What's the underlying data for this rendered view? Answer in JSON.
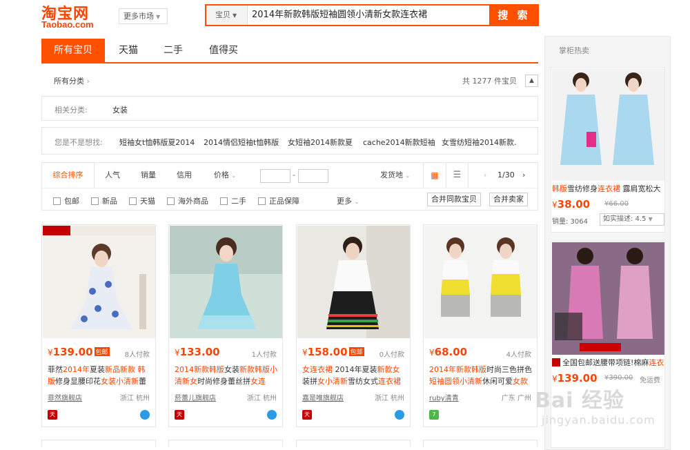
{
  "logo": {
    "cn": "淘宝网",
    "en": "Taobao.com"
  },
  "header": {
    "more_market": "更多市场",
    "search_type": "宝贝",
    "search_query": "2014年新款韩版短袖圆领小清新女款连衣裙",
    "search_button": "搜 索"
  },
  "tabs": [
    {
      "label": "所有宝贝",
      "active": true
    },
    {
      "label": "天猫",
      "active": false
    },
    {
      "label": "二手",
      "active": false
    },
    {
      "label": "值得买",
      "active": false
    }
  ],
  "breadcrumb": {
    "label": "所有分类",
    "count_text": "共 1277 件宝贝"
  },
  "related": {
    "label": "相关分类:",
    "value": "女装"
  },
  "suggest": {
    "label": "您是不是想找:",
    "items": [
      "短袖女t恤韩版夏2014",
      "2014情侣短袖t恤韩版",
      "女短袖2014新款夏",
      "cache2014新款短袖",
      "女雪纺短袖2014新款."
    ]
  },
  "sort": {
    "items": [
      "综合排序",
      "人气",
      "销量",
      "信用",
      "价格"
    ],
    "ship_from": "发货地",
    "page": "1/30",
    "filters": [
      "包邮",
      "新品",
      "天猫",
      "海外商品",
      "二手",
      "正品保障"
    ],
    "more": "更多",
    "merge_same": "合并同款宝贝",
    "merge_seller": "合并卖家"
  },
  "products": [
    {
      "price": "139.00",
      "free_ship": "包邮",
      "paid": "8人付款",
      "title_parts": [
        "菲然",
        "2014年",
        "夏装",
        "新品",
        "新款 ",
        "韩版",
        "修身显腰印花",
        "女装",
        "小清新",
        "蕾"
      ],
      "shop": "菲然旗舰店",
      "location": "浙江 杭州"
    },
    {
      "price": "133.00",
      "free_ship": "",
      "paid": "1人付款",
      "title_parts": [
        "2014新款",
        "韩版",
        "女装",
        "新款",
        "韩版",
        "小清新",
        "女",
        "时尚修身蕾丝拼",
        "女连"
      ],
      "shop": "菸蕾儿旗舰店",
      "location": "浙江 杭州"
    },
    {
      "price": "158.00",
      "free_ship": "包邮",
      "paid": "0人付款",
      "title_parts": [
        "女",
        "连衣裙",
        " 2014年",
        "夏装",
        "新款",
        "女",
        "装拼",
        "女",
        "小清新",
        "雪纺女式",
        "连衣裙"
      ],
      "shop": "嘉是唯旗舰店",
      "location": "浙江 杭州"
    },
    {
      "price": "68.00",
      "free_ship": "",
      "paid": "4人付款",
      "title_parts": [
        "2014年",
        "新款",
        "韩版",
        "时尚三色拼色",
        "短袖",
        "圆领",
        "小清新",
        "休闲可爱",
        "女款"
      ],
      "shop": "ruby清青",
      "location": "广东 广州"
    }
  ],
  "sidebar": {
    "title": "掌柜热卖",
    "items": [
      {
        "title_hl": "韩版",
        "title_mid": "雪纺修身",
        "title_hl2": "连衣裙",
        "title_end": " 露肩宽松大",
        "price": "38.00",
        "old_price": "66.00",
        "sales": "销量: 3064",
        "rating": "如实描述: 4.5"
      },
      {
        "title_pre": "全国包邮送腰带项链!",
        "title_mid": "棉麻",
        "title_hl": "连衣",
        "price": "139.00",
        "old_price": "390.00",
        "free": "免运费"
      }
    ]
  },
  "watermark": {
    "big": "Bai 经验",
    "small": "jingyan.baidu.com"
  },
  "colors": {
    "accent": "#ff5000",
    "price": "#ff4400"
  }
}
